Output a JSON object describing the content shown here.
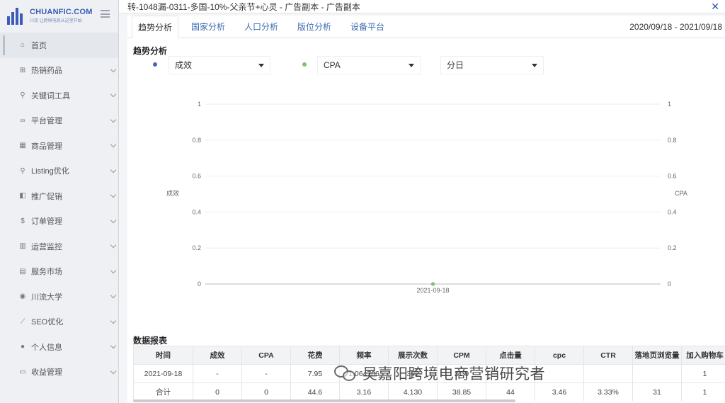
{
  "logo": {
    "title": "CHUANFIC.COM",
    "subtitle": "川流 让跨境电商从这里开始"
  },
  "sidebar": {
    "items": [
      {
        "label": "首页",
        "icon": "home-icon",
        "glyph": "⌂"
      },
      {
        "label": "热销药品",
        "icon": "cart-icon",
        "glyph": "⊞"
      },
      {
        "label": "关键词工具",
        "icon": "search-icon",
        "glyph": "⚲"
      },
      {
        "label": "平台管理",
        "icon": "binoculars-icon",
        "glyph": "∞"
      },
      {
        "label": "商品管理",
        "icon": "grid-icon",
        "glyph": "▦"
      },
      {
        "label": "Listing优化",
        "icon": "search-icon",
        "glyph": "⚲"
      },
      {
        "label": "推广促销",
        "icon": "megaphone-icon",
        "glyph": "◧"
      },
      {
        "label": "订单管理",
        "icon": "dollar-icon",
        "glyph": "$"
      },
      {
        "label": "运营监控",
        "icon": "bar-chart-icon",
        "glyph": "▥"
      },
      {
        "label": "服务市场",
        "icon": "map-icon",
        "glyph": "▤"
      },
      {
        "label": "川流大学",
        "icon": "check-circle-icon",
        "glyph": "◉"
      },
      {
        "label": "SEO优化",
        "icon": "line-chart-icon",
        "glyph": "⟋"
      },
      {
        "label": "个人信息",
        "icon": "user-icon",
        "glyph": "●"
      },
      {
        "label": "收益管理",
        "icon": "card-icon",
        "glyph": "▭"
      }
    ]
  },
  "window": {
    "title": "转-1048漏-0311-多国-10%-父亲节+心灵 - 广告副本 - 广告副本"
  },
  "tabs": [
    "趋势分析",
    "国家分析",
    "人口分析",
    "版位分析",
    "设备平台"
  ],
  "date_range": "2020/09/18 - 2021/09/18",
  "trend": {
    "title": "趋势分析",
    "metric1": {
      "value": "成效",
      "color": "#4a63b8"
    },
    "metric2": {
      "value": "CPA",
      "color": "#7cc36d"
    },
    "granularity": "分日"
  },
  "chart_data": {
    "type": "line",
    "x": [
      "2021-09-18"
    ],
    "series": [
      {
        "name": "成效",
        "values": [
          0
        ],
        "axis": "left",
        "color": "#4a63b8"
      },
      {
        "name": "CPA",
        "values": [
          0
        ],
        "axis": "right",
        "color": "#7cc36d"
      }
    ],
    "ylabel": "成效",
    "y2label": "CPA",
    "ylim": [
      0,
      1
    ],
    "y2lim": [
      0,
      1
    ],
    "yticks": [
      "0",
      "0.2",
      "0.4",
      "0.6",
      "0.8",
      "1"
    ],
    "grid": true
  },
  "report": {
    "title": "数据报表",
    "columns": [
      "时间",
      "成效",
      "CPA",
      "花费",
      "频率",
      "展示次数",
      "CPM",
      "点击量",
      "cpc",
      "CTR",
      "落地页浏览量",
      "加入购物车"
    ],
    "rows": [
      [
        "2021-09-18",
        "-",
        "-",
        "7.95",
        "1.064706",
        "362",
        "21.9",
        "",
        "",
        "",
        "",
        "1"
      ],
      [
        "合计",
        "0",
        "0",
        "44.6",
        "3.16",
        "4,130",
        "38.85",
        "44",
        "3.46",
        "3.33%",
        "31",
        "1"
      ]
    ]
  },
  "watermark": {
    "text": "吴嘉阳跨境电商营销研究者"
  }
}
